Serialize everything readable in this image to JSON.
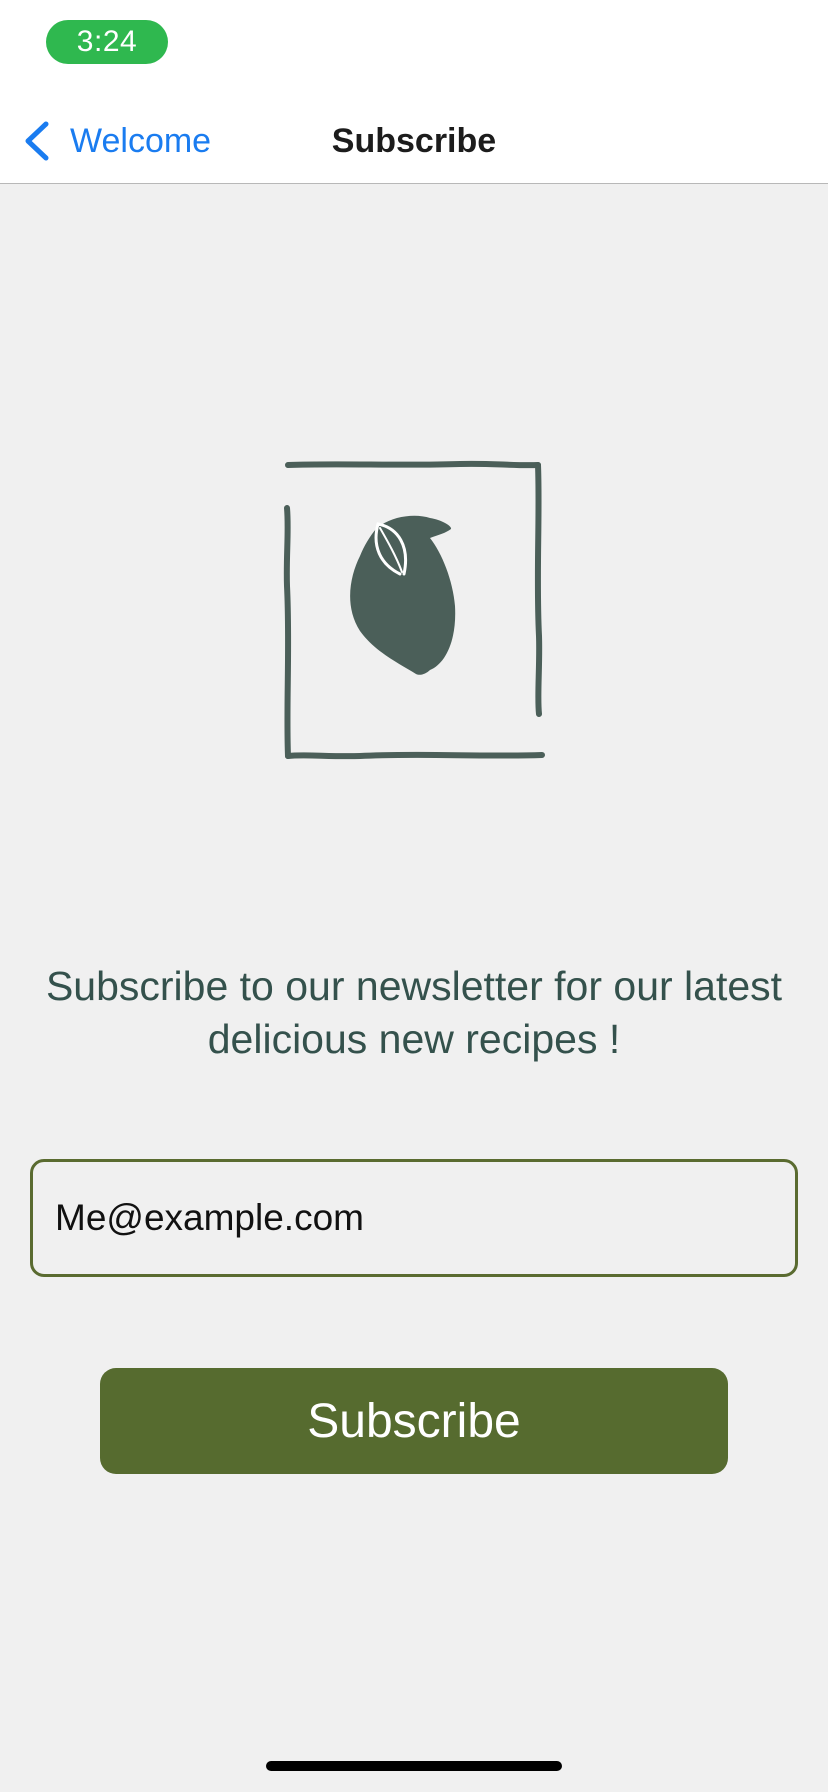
{
  "status_bar": {
    "time": "3:24",
    "pill_color": "#2fb84f"
  },
  "nav": {
    "back_label": "Welcome",
    "back_icon": "chevron-left-icon",
    "title": "Subscribe",
    "accent": "#1a7cf0"
  },
  "logo": {
    "icon": "lemon-leaf-logo",
    "color": "#4b5f59"
  },
  "main": {
    "headline_line1": "Subscribe to our newsletter for our latest",
    "headline_line2": "delicious new recipes !",
    "email_value": "Me@example.com",
    "subscribe_label": "Subscribe",
    "button_color": "#566b2f"
  }
}
